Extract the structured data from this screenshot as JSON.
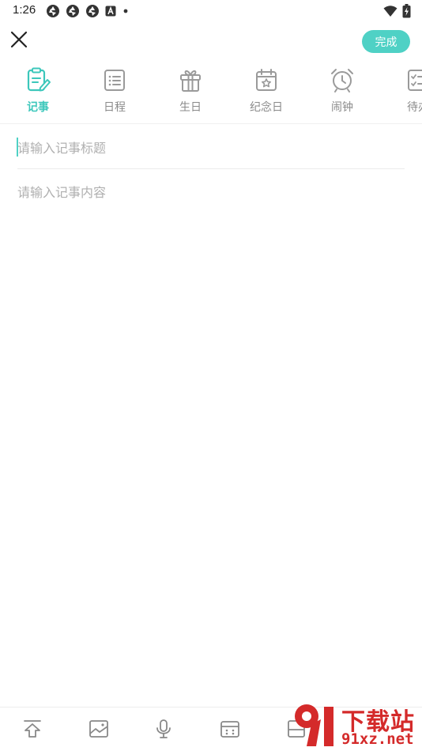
{
  "status_bar": {
    "time": "1:26",
    "left_icons": [
      "aperture-icon",
      "aperture-icon",
      "aperture-icon",
      "a-square-icon",
      "dot-icon"
    ],
    "right_icons": [
      "wifi-icon",
      "battery-charging-icon"
    ]
  },
  "header": {
    "close_icon": "close-icon",
    "done_label": "完成"
  },
  "tabs": [
    {
      "label": "记事",
      "icon": "note-edit-icon",
      "active": true
    },
    {
      "label": "日程",
      "icon": "schedule-list-icon",
      "active": false
    },
    {
      "label": "生日",
      "icon": "gift-icon",
      "active": false
    },
    {
      "label": "纪念日",
      "icon": "calendar-star-icon",
      "active": false
    },
    {
      "label": "闹钟",
      "icon": "alarm-clock-icon",
      "active": false
    },
    {
      "label": "待办",
      "icon": "todo-checklist-icon",
      "active": false
    }
  ],
  "editor": {
    "title_placeholder": "请输入记事标题",
    "title_value": "",
    "content_placeholder": "请输入记事内容",
    "content_value": ""
  },
  "toolbar": {
    "items": [
      "upload-arrow-icon",
      "image-icon",
      "microphone-icon",
      "calendar-grid-icon",
      "template-icon"
    ]
  },
  "watermark": {
    "title": "下载站",
    "url": "91xz.net"
  },
  "colors": {
    "accent": "#4fd1c5",
    "accent_text": "#3cc7bb",
    "inactive_text": "#8a8a8a",
    "placeholder": "#b0b0b0",
    "watermark": "#d42a2a"
  }
}
